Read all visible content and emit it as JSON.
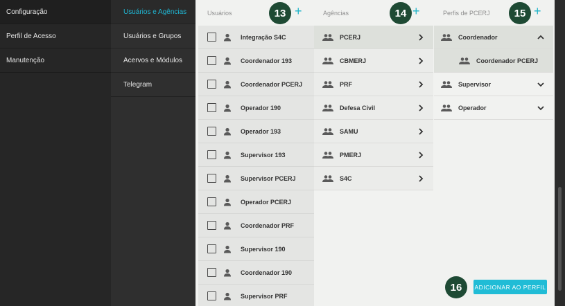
{
  "nav_primary": [
    {
      "label": "Configuração",
      "active": true
    },
    {
      "label": "Perfil de Acesso",
      "active": false
    },
    {
      "label": "Manutenção",
      "active": false
    }
  ],
  "nav_secondary": [
    {
      "label": "Usuários e Agências",
      "active": true
    },
    {
      "label": "Usuários e Grupos",
      "active": false
    },
    {
      "label": "Acervos e Módulos",
      "active": false
    },
    {
      "label": "Telegram",
      "active": false
    }
  ],
  "columns": {
    "users": {
      "title": "Usuários",
      "badge": "13"
    },
    "agencies": {
      "title": "Agências",
      "badge": "14"
    },
    "profiles": {
      "title": "Perfis de PCERJ",
      "badge": "15"
    }
  },
  "plus_glyph": "+",
  "users": [
    {
      "name": "Integração S4C"
    },
    {
      "name": "Coordenador 193"
    },
    {
      "name": "Coordenador PCERJ"
    },
    {
      "name": "Operador 190"
    },
    {
      "name": "Operador 193"
    },
    {
      "name": "Supervisor 193"
    },
    {
      "name": "Supervisor PCERJ"
    },
    {
      "name": "Operador PCERJ"
    },
    {
      "name": "Coordenador PRF"
    },
    {
      "name": "Supervisor 190"
    },
    {
      "name": "Coordenador 190"
    },
    {
      "name": "Supervisor PRF"
    }
  ],
  "agencies": [
    {
      "name": "PCERJ"
    },
    {
      "name": "CBMERJ"
    },
    {
      "name": "PRF"
    },
    {
      "name": "Defesa Civil"
    },
    {
      "name": "SAMU"
    },
    {
      "name": "PMERJ"
    },
    {
      "name": "S4C"
    }
  ],
  "profiles": [
    {
      "name": "Coordenador",
      "expanded": true
    },
    {
      "name": "Coordenador PCERJ",
      "child": true
    },
    {
      "name": "Supervisor",
      "expanded": false
    },
    {
      "name": "Operador",
      "expanded": false
    }
  ],
  "add_button": {
    "label": "ADICIONAR AO PERFIL",
    "badge": "16"
  },
  "colors": {
    "accent": "#20bcd6",
    "badge": "#1e4a34",
    "active_nav": "#20b6d3"
  }
}
